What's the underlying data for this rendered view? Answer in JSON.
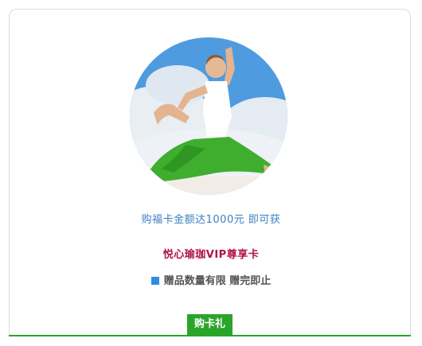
{
  "photo": {
    "icon": "yoga-woman-photo",
    "sky_color": "#4f9be0",
    "pants_color": "#3fae2f"
  },
  "promo_text": "购福卡金额达1000元 即可获",
  "card_name": "悦心瑜珈VIP尊享卡",
  "notice": {
    "bullet_color": "#2f8ee0",
    "text": "赠品数量有限 赠完即止"
  },
  "buy_button": {
    "label": "购卡礼",
    "color": "#2aa52a"
  }
}
